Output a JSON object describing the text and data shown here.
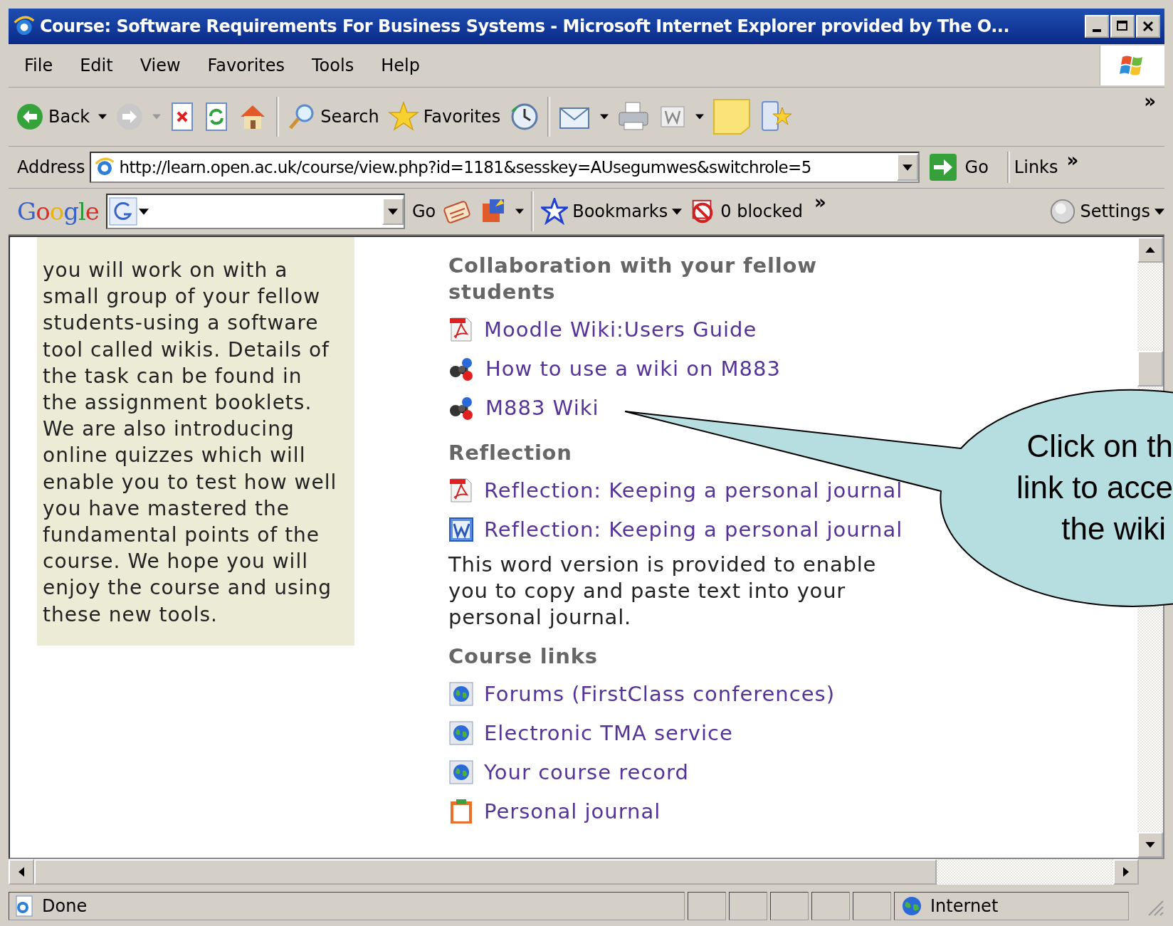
{
  "window": {
    "title": "Course: Software Requirements For Business Systems - Microsoft Internet Explorer provided by The O..."
  },
  "menu": [
    "File",
    "Edit",
    "View",
    "Favorites",
    "Tools",
    "Help"
  ],
  "toolbar": {
    "back": "Back",
    "search": "Search",
    "favorites": "Favorites",
    "more": "»"
  },
  "address_bar": {
    "label": "Address",
    "url": "http://learn.open.ac.uk/course/view.php?id=1181&sesskey=AUsegumwes&switchrole=5",
    "go": "Go",
    "links": "Links",
    "more": "»"
  },
  "google_bar": {
    "logo": "Google",
    "go": "Go",
    "bookmarks": "Bookmarks",
    "blocked": "0 blocked",
    "more": "»",
    "settings": "Settings"
  },
  "sidebar": {
    "text": "you will work on with a small group of your fellow students-using a software tool called wikis. Details of the task can be found in the assignment booklets. We are also introducing online quizzes which will enable you to test how well you have mastered the fundamental points of the course. We hope you will enjoy the course and using these new tools."
  },
  "sections": [
    {
      "heading": "Collaboration with your fellow students",
      "items": [
        {
          "kind": "pdf",
          "label": "Moodle Wiki:Users Guide"
        },
        {
          "kind": "wiki",
          "label": "How to use a wiki on M883"
        },
        {
          "kind": "wiki",
          "label": "M883 Wiki"
        }
      ]
    },
    {
      "heading": "Reflection",
      "items": [
        {
          "kind": "pdf",
          "label": "Reflection: Keeping a personal journal"
        },
        {
          "kind": "word",
          "label": "Reflection: Keeping a personal journal"
        }
      ],
      "note": "This word version is provided to enable you to copy and paste text into your personal journal."
    },
    {
      "heading": "Course links",
      "items": [
        {
          "kind": "web",
          "label": "Forums (FirstClass conferences)"
        },
        {
          "kind": "web",
          "label": "Electronic TMA service"
        },
        {
          "kind": "web",
          "label": "Your course record"
        },
        {
          "kind": "journal",
          "label": "Personal journal"
        }
      ]
    }
  ],
  "callout": {
    "lines": [
      "Click on th",
      "link to acce",
      "the wiki"
    ]
  },
  "status_bar": {
    "text": "Done",
    "zone": "Internet"
  }
}
